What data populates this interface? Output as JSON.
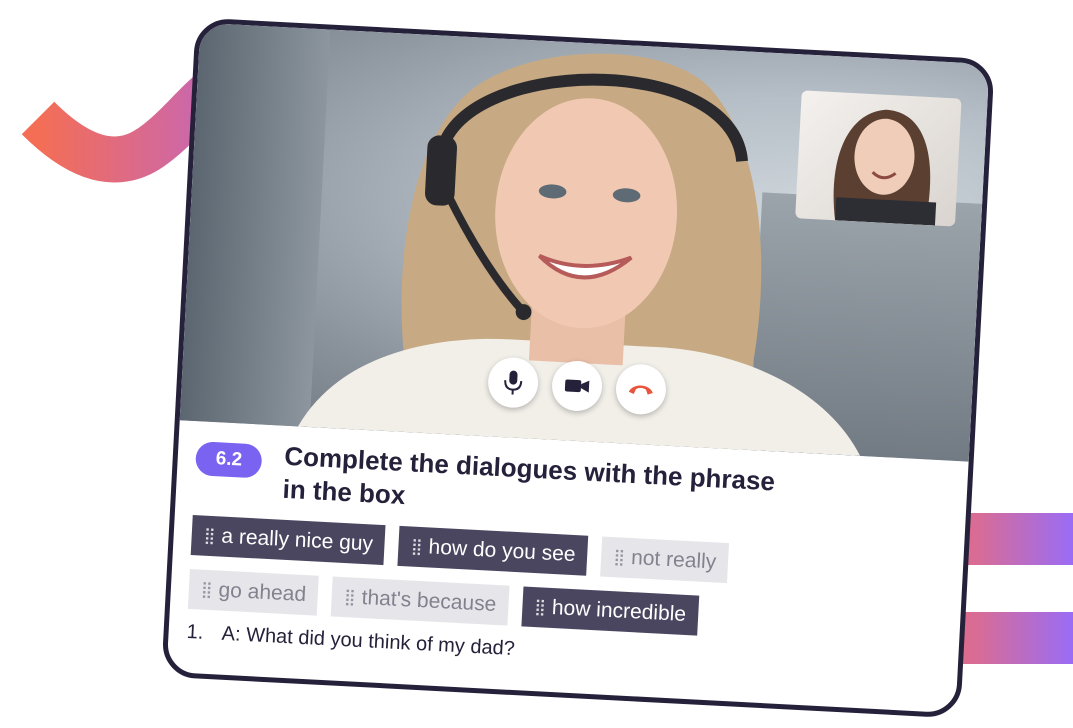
{
  "call": {
    "controls": [
      {
        "name": "microphone-button",
        "icon": "microphone-icon"
      },
      {
        "name": "camera-button",
        "icon": "video-camera-icon"
      },
      {
        "name": "end-call-button",
        "icon": "phone-hangup-icon"
      }
    ],
    "colors": {
      "end_call": "#e8543c",
      "control_icon": "#25213b"
    }
  },
  "exercise": {
    "number": "6.2",
    "title": "Complete the dialogues with the phrase in the box",
    "phrases": [
      {
        "text": "a really nice guy",
        "state": "dark"
      },
      {
        "text": "how do you see",
        "state": "dark"
      },
      {
        "text": "not really",
        "state": "light"
      },
      {
        "text": "go ahead",
        "state": "light"
      },
      {
        "text": "that's because",
        "state": "light"
      },
      {
        "text": "how incredible",
        "state": "dark"
      }
    ],
    "question": {
      "number": "1.",
      "text": "A: What did you think of my dad?"
    }
  },
  "colors": {
    "accent": "#7a63f0",
    "chip_dark": "#4a4660",
    "chip_light": "#e6e5ea",
    "frame": "#25213b",
    "gradient_start": "#f46e55",
    "gradient_end": "#9a6cf6"
  }
}
